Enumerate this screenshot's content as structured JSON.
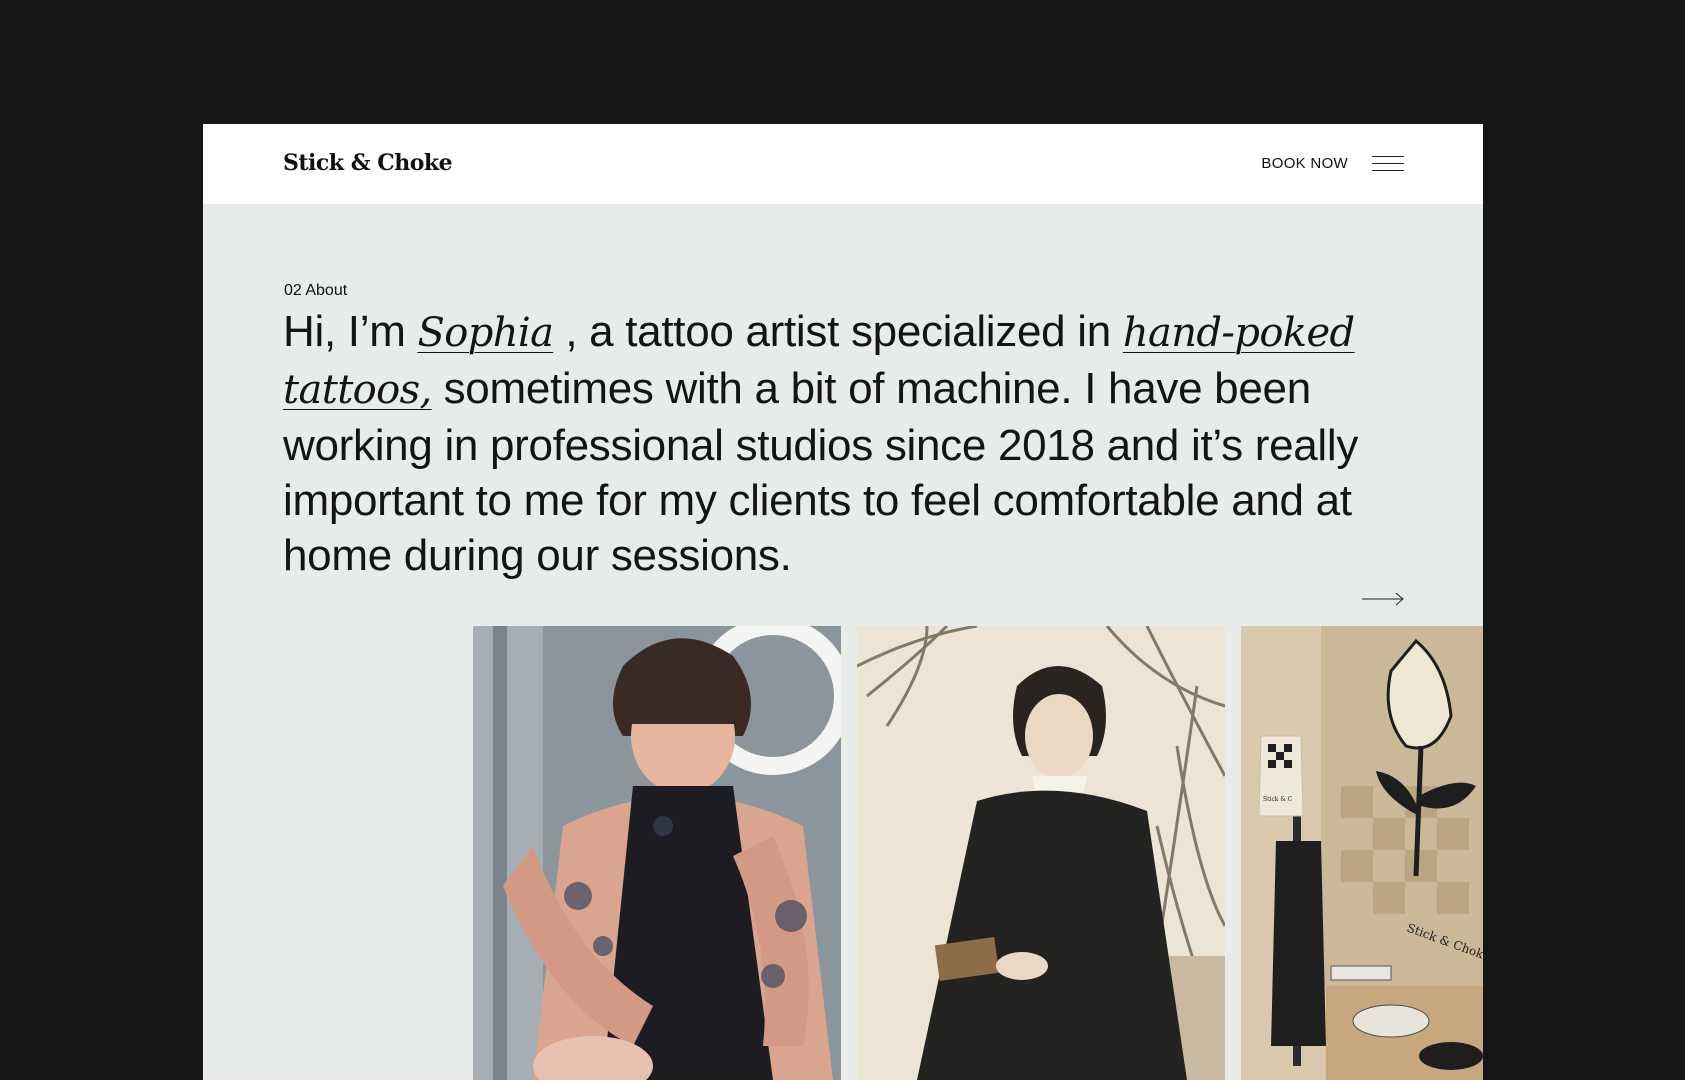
{
  "header": {
    "logo": "Stick & Choke",
    "book_now_label": "BOOK NOW",
    "menu_icon": "hamburger-icon"
  },
  "about": {
    "section_label": "02 About",
    "intro_part1": "Hi, I’m ",
    "intro_name": "Sophia",
    "intro_part2": " , a tattoo artist specialized in ",
    "intro_specialty": "hand-poked tattoos,",
    "intro_part3": " sometimes with a bit of machine. I have been working in professional studios since 2018 and it’s really important to me for my clients to feel comfortable and at home during our sessions.",
    "next_icon": "arrow-right-icon"
  },
  "gallery": {
    "photo_banner_text": "Stick & Choke",
    "photo_tote_text": "Stick & C"
  },
  "colors": {
    "page_background": "#161619",
    "header_background": "#ffffff",
    "section_background": "#e7ece8",
    "text": "#141417"
  }
}
